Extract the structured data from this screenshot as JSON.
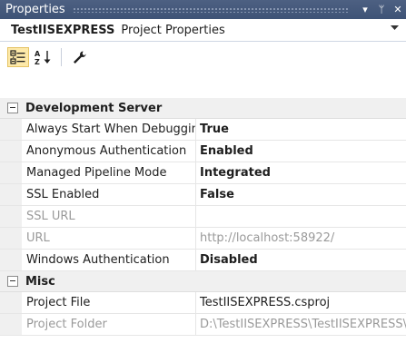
{
  "window": {
    "title": "Properties",
    "buttons": {
      "dropdown": "▾",
      "pin": "ᛘ",
      "close": "✕"
    }
  },
  "selector": {
    "object_name": "TestIISEXPRESS",
    "object_type": "Project Properties",
    "dropdown_icon": "chevron-down-icon"
  },
  "toolbar": {
    "buttons": [
      {
        "name": "categorized-button",
        "icon": "categorized-icon",
        "active": true
      },
      {
        "name": "alphabetical-button",
        "icon": "sort-az-icon",
        "active": false
      },
      {
        "name": "property-pages-button",
        "icon": "wrench-icon",
        "active": false
      }
    ]
  },
  "grid": {
    "categories": [
      {
        "label": "Development Server",
        "properties": [
          {
            "name": "Always Start When Debugging",
            "value": "True",
            "bold": true,
            "disabled": false
          },
          {
            "name": "Anonymous Authentication",
            "value": "Enabled",
            "bold": true,
            "disabled": false
          },
          {
            "name": "Managed Pipeline Mode",
            "value": "Integrated",
            "bold": true,
            "disabled": false
          },
          {
            "name": "SSL Enabled",
            "value": "False",
            "bold": true,
            "disabled": false
          },
          {
            "name": "SSL URL",
            "value": "",
            "bold": false,
            "disabled": true
          },
          {
            "name": "URL",
            "value": "http://localhost:58922/",
            "bold": false,
            "disabled": true
          },
          {
            "name": "Windows Authentication",
            "value": "Disabled",
            "bold": true,
            "disabled": false
          }
        ]
      },
      {
        "label": "Misc",
        "properties": [
          {
            "name": "Project File",
            "value": "TestIISEXPRESS.csproj",
            "bold": false,
            "disabled": false
          },
          {
            "name": "Project Folder",
            "value": "D:\\TestIISEXPRESS\\TestIISEXPRESS\\",
            "bold": false,
            "disabled": true
          }
        ]
      }
    ]
  },
  "colors": {
    "titlebar": "#3e5376",
    "category_bg": "#f0f0f0",
    "active_button": "#fde9a9",
    "disabled_text": "#9a9a9a"
  }
}
